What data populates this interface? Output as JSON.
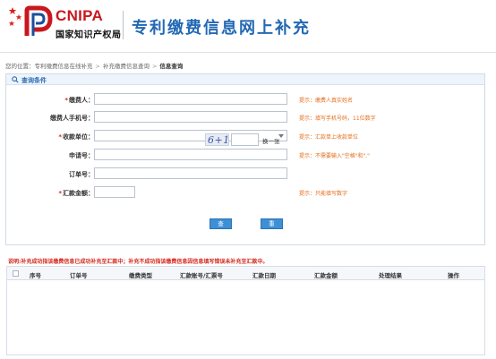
{
  "header": {
    "logo_en": "CNIPA",
    "logo_cn": "国家知识产权局",
    "title": "专利缴费信息网上补充"
  },
  "breadcrumb": {
    "prefix": "您的位置：",
    "items": [
      "专利缴费信息在线补充",
      "补充缴费信息查询",
      "信息查询"
    ]
  },
  "query": {
    "title": "查询条件",
    "fields": [
      {
        "label": "缴费人：",
        "required": true,
        "value": "",
        "hint": "提示：缴费人真实姓名"
      },
      {
        "label": "缴费人手机号：",
        "required": false,
        "value": "",
        "hint": "提示：填写手机号码，11位数字"
      },
      {
        "label": "收款单位：",
        "required": true,
        "value": "",
        "hint": "提示：汇款单上收款单位"
      },
      {
        "label": "申请号：",
        "required": false,
        "value": "",
        "hint": "提示：不需要输入\"空格\"和\".\""
      },
      {
        "label": "订单号：",
        "required": false,
        "value": "",
        "hint": ""
      },
      {
        "label": "汇款金额：",
        "required": true,
        "value": "",
        "hint": "提示：只能填写数字"
      }
    ],
    "captcha_text": "6+1",
    "captcha_refresh": "换一张",
    "query_button": "查询",
    "reset_button": "重填"
  },
  "results": {
    "notice": "说明:补充成功指该缴费信息已成功补充至汇款中；补充不成功指该缴费信息因信息填写错误未补充至汇款中。",
    "columns": [
      "序号",
      "订单号",
      "缴费类型",
      "汇款账号/汇票号",
      "汇款日期",
      "汇款金额",
      "处理结果",
      "操作"
    ],
    "rows": []
  },
  "colors": {
    "brand_red": "#c8181e",
    "title_blue": "#2368b4",
    "button_blue": "#3d8fd6",
    "hint_orange": "#e46d1a",
    "notice_red": "#d4281d"
  }
}
